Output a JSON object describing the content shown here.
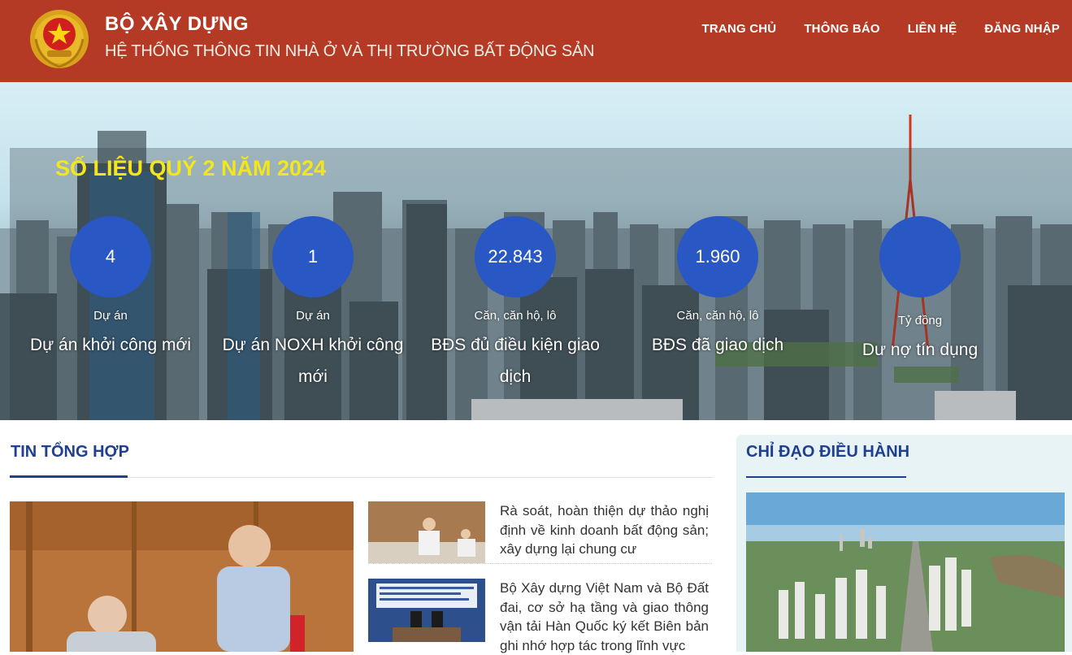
{
  "header": {
    "title": "BỘ XÂY DỰNG",
    "subtitle": "HỆ THỐNG THÔNG TIN NHÀ Ở VÀ THỊ TRƯỜNG BẤT ĐỘNG SẢN",
    "nav": [
      "TRANG CHỦ",
      "THÔNG BÁO",
      "LIÊN HỆ",
      "ĐĂNG NHẬP"
    ]
  },
  "stats": {
    "title": "SỐ LIỆU QUÝ 2 NĂM 2024",
    "items": [
      {
        "value": "4",
        "unit": "Dự án",
        "label": "Dự án khởi công mới"
      },
      {
        "value": "1",
        "unit": "Dự án",
        "label": "Dự án NOXH khởi công mới"
      },
      {
        "value": "22.843",
        "unit": "Căn, căn hộ, lô",
        "label": "BĐS đủ điều kiện giao dịch"
      },
      {
        "value": "1.960",
        "unit": "Căn, căn hộ, lô",
        "label": "BĐS đã giao dịch"
      },
      {
        "value": "",
        "unit": "Tỷ đồng",
        "label": "Dư nợ tín dụng"
      }
    ]
  },
  "news": {
    "section_title": "TIN TỔNG HỢP",
    "items": [
      {
        "text": "Rà soát, hoàn thiện dự thảo nghị định về kinh doanh bất động sản; xây dựng lại chung cư"
      },
      {
        "text": "Bộ Xây dựng Việt Nam và Bộ Đất đai, cơ sở hạ tầng và giao thông vận tải Hàn Quốc ký kết Biên bản ghi nhớ hợp tác trong lĩnh vực"
      }
    ]
  },
  "sidebar": {
    "title": "CHỈ ĐẠO ĐIỀU HÀNH"
  },
  "colors": {
    "header_bg": "#b53a26",
    "stat_circle": "#2957c4",
    "stats_title": "#f5e51b",
    "section_title": "#1f3f8f"
  },
  "icons": {
    "emblem": "national-emblem-icon"
  }
}
